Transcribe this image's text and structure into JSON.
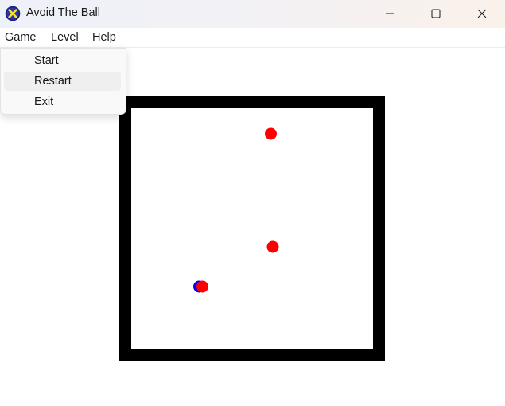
{
  "window": {
    "title": "Avoid The Ball",
    "icon": "app-x-icon",
    "controls": [
      "minimize-icon",
      "maximize-icon",
      "close-icon"
    ]
  },
  "menu": {
    "items": [
      {
        "label": "Game"
      },
      {
        "label": "Level"
      },
      {
        "label": "Help"
      }
    ],
    "open_menu": "Game",
    "game_dropdown": [
      {
        "label": "Start"
      },
      {
        "label": "Restart",
        "highlighted": true
      },
      {
        "label": "Exit"
      }
    ]
  },
  "game": {
    "wall_color": "#000000",
    "field_color": "#ffffff",
    "enemy_color": "#ff0000",
    "player_colors": [
      "#0000ff",
      "#ff0000"
    ]
  }
}
